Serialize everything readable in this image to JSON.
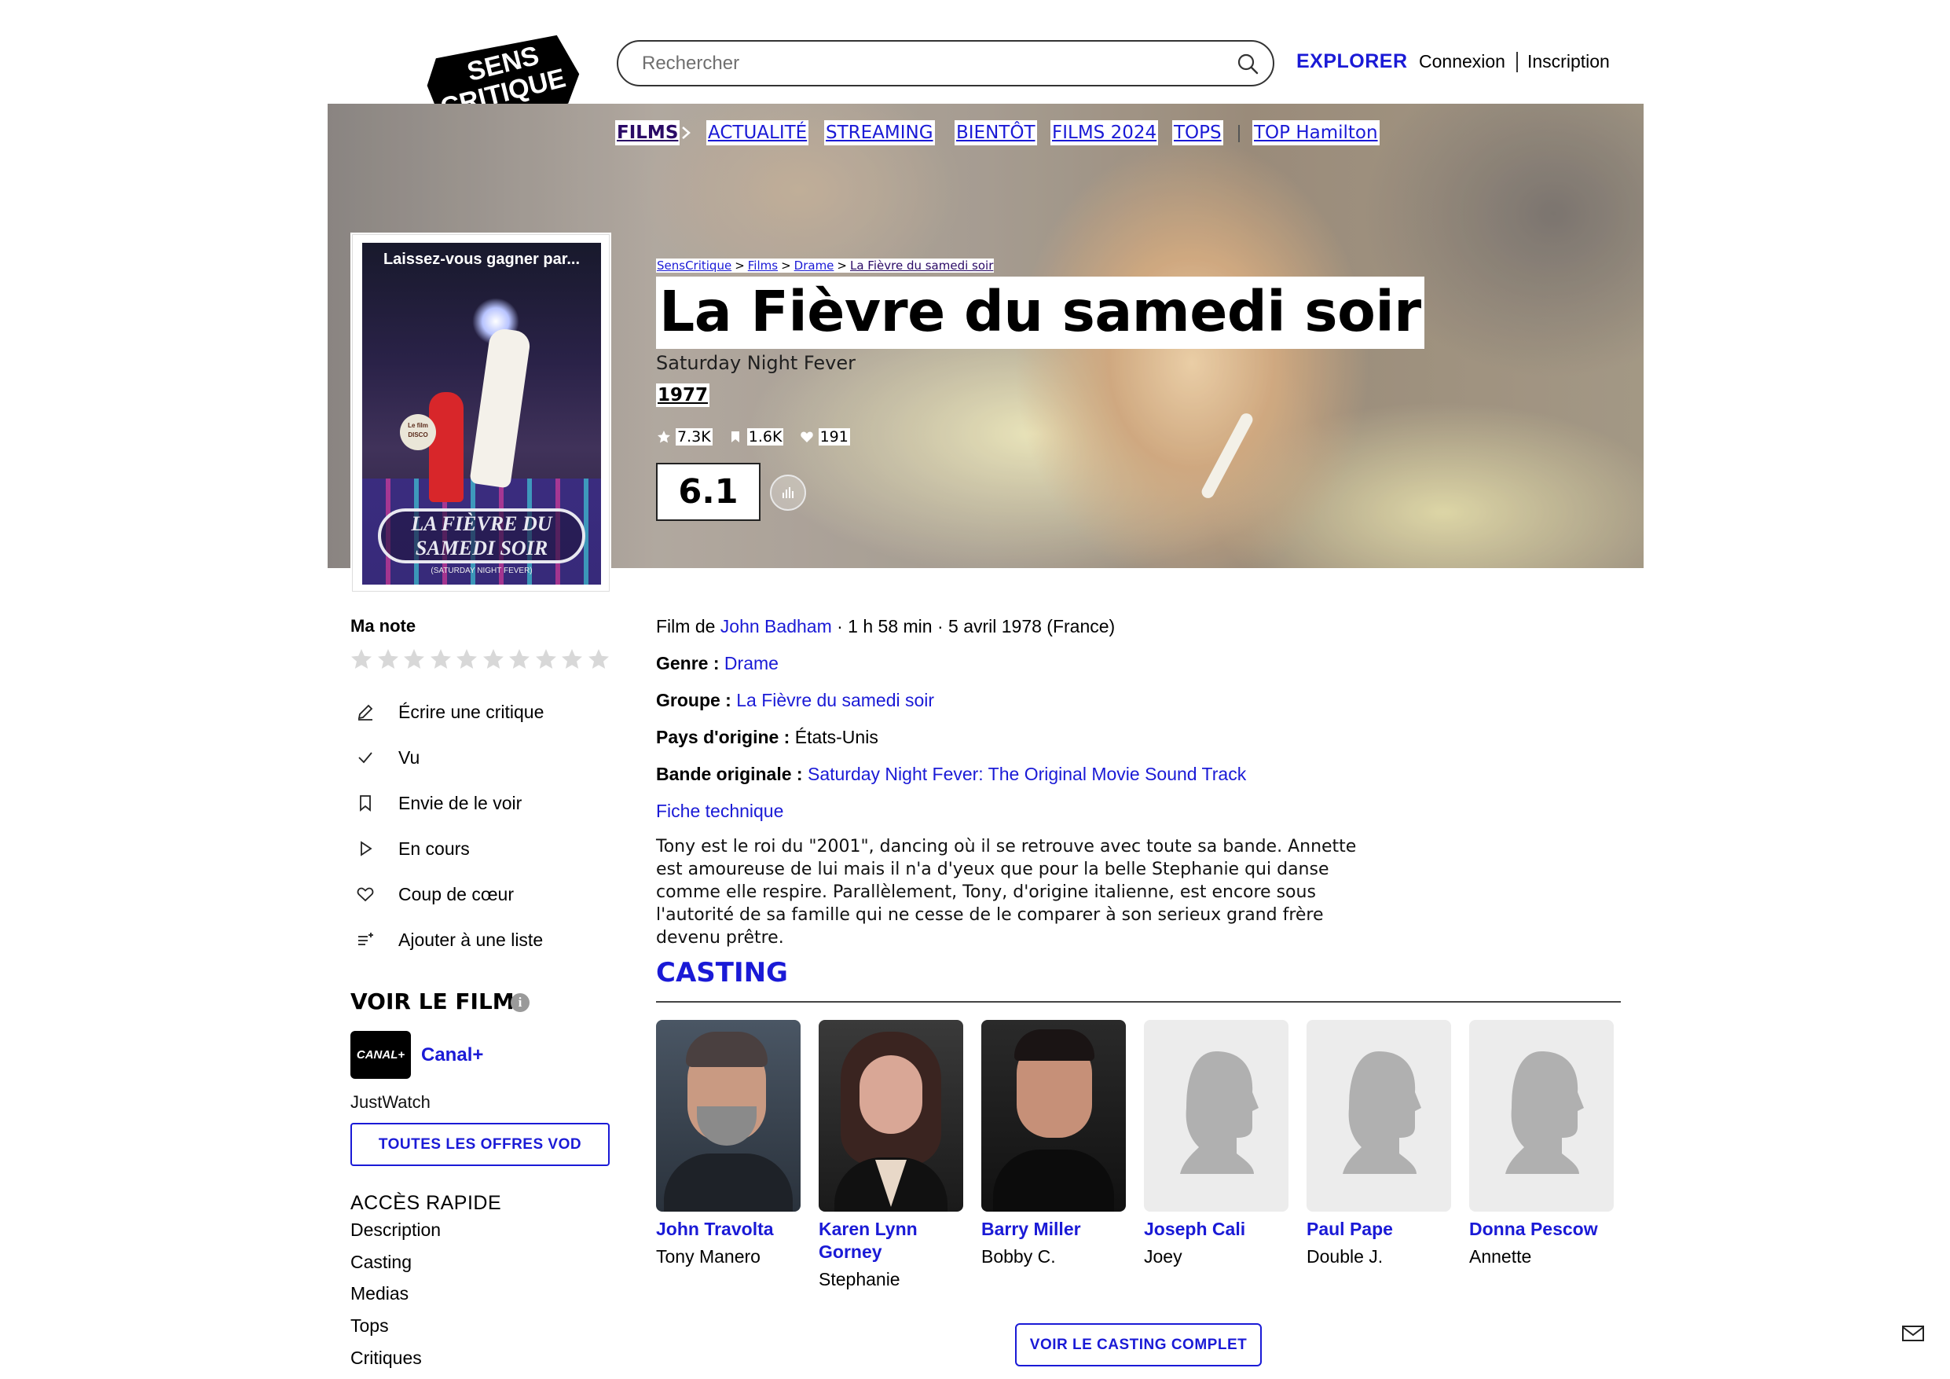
{
  "header": {
    "logo_text": "SENS CRITIQUE",
    "search_placeholder": "Rechercher",
    "explorer": "EXPLORER",
    "login": "Connexion",
    "signup": "Inscription"
  },
  "nav": {
    "films": "FILMS",
    "items": [
      "ACTUALITÉ",
      "STREAMING",
      "BIENTÔT",
      "FILMS 2024",
      "TOPS"
    ],
    "top": "TOP Hamilton"
  },
  "poster": {
    "tagline": "Laissez-vous gagner par...",
    "title": "LA FIÈVRE DU SAMEDI SOIR",
    "subtitle": "(SATURDAY NIGHT FEVER)",
    "badge": "Le film DISCO"
  },
  "breadcrumb": [
    "SensCritique",
    "Films",
    "Drame",
    "La Fièvre du samedi soir"
  ],
  "movie": {
    "title": "La Fièvre du samedi soir",
    "original_title": "Saturday Night Fever",
    "year": "1977",
    "stats": {
      "ratings": "7.3K",
      "wishlist": "1.6K",
      "favorites": "191"
    },
    "rating": "6.1"
  },
  "sidebar": {
    "my_rating": "Ma note",
    "star_count": 10,
    "actions": [
      {
        "label": "Écrire une critique",
        "icon": "pencil-icon"
      },
      {
        "label": "Vu",
        "icon": "check-icon"
      },
      {
        "label": "Envie de le voir",
        "icon": "bookmark-icon"
      },
      {
        "label": "En cours",
        "icon": "play-icon"
      },
      {
        "label": "Coup de cœur",
        "icon": "heart-icon"
      },
      {
        "label": "Ajouter à une liste",
        "icon": "list-add-icon"
      }
    ],
    "watch_title": "VOIR LE FILM",
    "provider_logo": "CANAL+",
    "provider": "Canal+",
    "justwatch": "JustWatch",
    "vod_button": "TOUTES LES OFFRES VOD",
    "quick_title": "ACCÈS RAPIDE",
    "quick_links": [
      "Description",
      "Casting",
      "Medias",
      "Tops",
      "Critiques"
    ]
  },
  "details": {
    "film_by_prefix": "Film de",
    "director": "John Badham",
    "meta": "· 1 h 58 min · 5 avril 1978 (France)",
    "genre_label": "Genre :",
    "genre": "Drame",
    "group_label": "Groupe :",
    "group": "La Fièvre du samedi soir",
    "country_label": "Pays d'origine :",
    "country": "États-Unis",
    "soundtrack_label": "Bande originale :",
    "soundtrack": "Saturday Night Fever: The Original Movie Sound Track",
    "tech_sheet": "Fiche technique",
    "synopsis": "Tony est le roi du \"2001\", dancing où il se retrouve avec toute sa bande. Annette est amoureuse de lui mais il n'a d'yeux que pour la belle Stephanie qui danse comme elle respire. Parallèlement, Tony, d'origine italienne, est encore sous l'autorité de sa famille qui ne cesse de le comparer à son serieux grand frère devenu prêtre."
  },
  "casting": {
    "title": "CASTING",
    "people": [
      {
        "name": "John Travolta",
        "role": "Tony Manero",
        "photo": "photo"
      },
      {
        "name": "Karen Lynn Gorney",
        "role": "Stephanie",
        "photo": "photo"
      },
      {
        "name": "Barry Miller",
        "role": "Bobby C.",
        "photo": "photo"
      },
      {
        "name": "Joseph Cali",
        "role": "Joey",
        "photo": "placeholder"
      },
      {
        "name": "Paul Pape",
        "role": "Double J.",
        "photo": "placeholder"
      },
      {
        "name": "Donna Pescow",
        "role": "Annette",
        "photo": "placeholder"
      }
    ],
    "full_cast_button": "VOIR LE CASTING COMPLET"
  },
  "colors": {
    "accent": "#1a1ad6",
    "nav_active": "#2a0a66",
    "placeholder_bg": "#ececec"
  }
}
